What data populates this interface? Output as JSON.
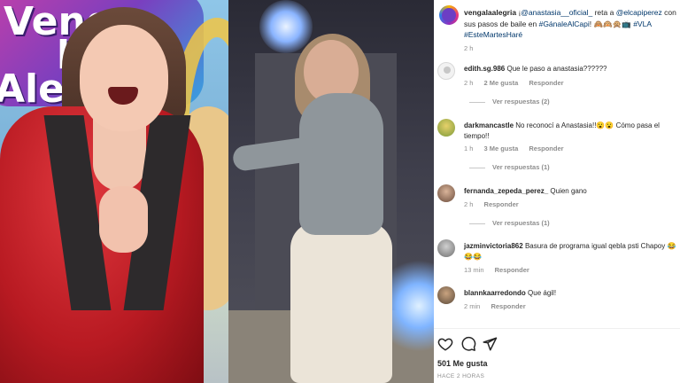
{
  "banner": {
    "line1": "Venga",
    "line2": "la",
    "line3": "Alegría"
  },
  "post": {
    "account": "vengalaalegria",
    "caption_parts": [
      "¡",
      "@anastasia__oficial_",
      " reta a ",
      "@elcapiperez",
      " con sus pasos de baile en ",
      "#GánaleAlCapi",
      "! 🙈🙉🙊📺 ",
      "#VLA",
      " ",
      "#EsteMartesHaré"
    ],
    "age": "2 h"
  },
  "comments": [
    {
      "user": "edith.sg.986",
      "text": "Que le paso a anastasia??????",
      "age": "2 h",
      "likes": "2 Me gusta",
      "reply": "Responder",
      "view_replies": "Ver respuestas (2)"
    },
    {
      "user": "darkmancastle",
      "text": "No reconocí a Anastasia!!😮😮 Cómo pasa el tiempo!!",
      "age": "1 h",
      "likes": "3 Me gusta",
      "reply": "Responder",
      "view_replies": "Ver respuestas (1)"
    },
    {
      "user": "fernanda_zepeda_perez_",
      "text": "Quien gano",
      "age": "2 h",
      "likes": "",
      "reply": "Responder",
      "view_replies": "Ver respuestas (1)"
    },
    {
      "user": "jazminvictoria862",
      "text": "Basura de programa igual qebla psti Chapoy 😂😂😂",
      "age": "13 min",
      "likes": "",
      "reply": "Responder",
      "view_replies": ""
    },
    {
      "user": "blannkaarredondo",
      "text": "Que ágil!",
      "age": "2 min",
      "likes": "",
      "reply": "Responder",
      "view_replies": ""
    }
  ],
  "actions": {
    "like_icon": "heart-icon",
    "comment_icon": "comment-icon",
    "share_icon": "share-icon",
    "likes_count": "501 Me gusta",
    "time_ago": "HACE 2 HORAS"
  },
  "colors": {
    "link": "#00376b",
    "text": "#262626",
    "muted": "#8e8e8e"
  }
}
